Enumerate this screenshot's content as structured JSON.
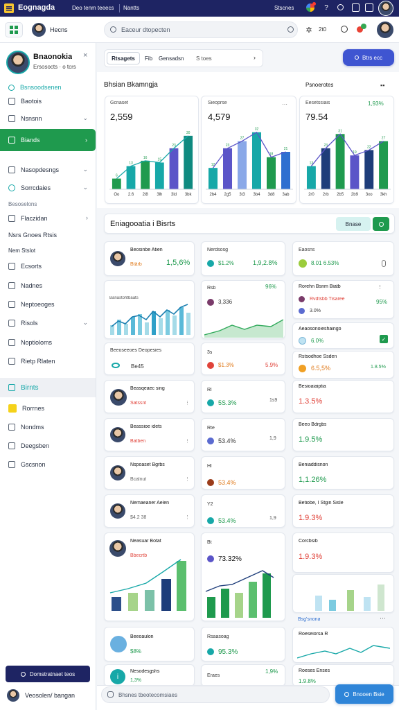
{
  "topbar": {
    "app_name": "Eognagda",
    "menu_1": "Deo tenm teeecs",
    "menu_2": "Nantts",
    "right_label": "Stscnes"
  },
  "header": {
    "left_label": "Hecns",
    "search_placeholder": "Eaceur dtopecten",
    "counter": "2t0"
  },
  "sidebar": {
    "profile_name": "Bnaonokia",
    "profile_sub": "Ersosocts · o tcrs",
    "items": [
      {
        "label": "Bsnsoodsenen"
      },
      {
        "label": "Baotois"
      },
      {
        "label": "Nsnsnn"
      },
      {
        "label": "Biands"
      },
      {
        "label": "Nasopdesngs"
      },
      {
        "label": "Sorrcdaies"
      },
      {
        "label": "Besoselons"
      },
      {
        "label": "Flaczidan"
      },
      {
        "label": "Nsrs Gnoes Rtsis"
      },
      {
        "label": "Nem Stslot"
      },
      {
        "label": "Ecsorts"
      },
      {
        "label": "Nadnes"
      },
      {
        "label": "Neptoeoges"
      },
      {
        "label": "Risols"
      },
      {
        "label": "Noptioloms"
      },
      {
        "label": "Rietp Rlaten"
      },
      {
        "label": "Birnts"
      },
      {
        "label": "Rorrnes"
      },
      {
        "label": "Nondms"
      },
      {
        "label": "Deegsben"
      },
      {
        "label": "Gscsnon"
      }
    ],
    "bottom_button": "Domstratnaet teos",
    "user_name": "Veosolen/ bangan"
  },
  "tabs": [
    "Rtsagets",
    "Fib",
    "Gensadsn",
    "S toes"
  ],
  "action_button": "Btrs ecc",
  "section1": {
    "title": "Bhsian Bkamngja",
    "side_title": "Psnoerotes"
  },
  "charts": [
    {
      "label": "Gcnaset",
      "value": "2,559"
    },
    {
      "label": "Sieoprse",
      "value": "4,579"
    },
    {
      "label": "Eesetssiais",
      "value": "79.54",
      "change": "1,93%"
    }
  ],
  "chart_data": [
    {
      "type": "bar",
      "categories": [
        "Oo",
        "2.6",
        "2l8",
        "3lh",
        "3ld",
        "3bk"
      ],
      "values": [
        6,
        13,
        16,
        15,
        23,
        30
      ],
      "ylim": [
        0,
        35
      ]
    },
    {
      "type": "bar",
      "categories": [
        "2b4",
        "2g5",
        "3t3",
        "3b4",
        "3d8",
        "3ab"
      ],
      "values": [
        12,
        23,
        27,
        32,
        18,
        21
      ],
      "ylim": [
        0,
        35
      ]
    },
    {
      "type": "bar",
      "categories": [
        "2r0",
        "2rb",
        "2b5",
        "2b9",
        "3xo",
        "3kh"
      ],
      "values": [
        13,
        23,
        31,
        19,
        22,
        27
      ],
      "ylim": [
        0,
        35
      ]
    }
  ],
  "section2": {
    "title": "Eniagooatia i Bisrts",
    "button": "Bnase"
  },
  "col1": [
    {
      "name": "Beosinbe Atien",
      "value": "1,5,6%",
      "sub": "Btärb"
    },
    {
      "name": "Banastohtbaats",
      "value": "",
      "sub": ""
    },
    {
      "name": "Beeoseeoes Deopesies",
      "value": "Be45",
      "sub": ""
    },
    {
      "name": "Beasqeaec sing",
      "value": "",
      "sub": "Satssnt"
    },
    {
      "name": "Beassioe idets",
      "value": "",
      "sub": "Batben"
    },
    {
      "name": "Nspoaset Bgrbs",
      "value": "",
      "sub": "Bcalnut"
    },
    {
      "name": "Nemaeaner Aelen",
      "value": "",
      "sub": "$4.2 38"
    },
    {
      "name": "Neasuar Botat",
      "value": "",
      "sub": "Bbecrtb"
    },
    {
      "name": "Beeoaulon",
      "value": "",
      "sub": "$8%"
    },
    {
      "name": "Nesodesgshs",
      "value": "1,3%",
      "sub": ""
    }
  ],
  "col2": [
    {
      "name": "Nerdsosg",
      "value": "$1.2%",
      "pct": "1,9,2.8%"
    },
    {
      "name": "Rsb",
      "value": "3,336",
      "pct": "96%"
    },
    {
      "name": "3s",
      "value": "$1.3%",
      "pct": "5.9%"
    },
    {
      "name": "Rl",
      "value": "5S.3%",
      "pct": "1s9"
    },
    {
      "name": "Rte",
      "value": "53.4%",
      "pct": "1,9"
    },
    {
      "name": "Hl",
      "value": "53.4%",
      "pct": ""
    },
    {
      "name": "Y2",
      "value": "53.4%",
      "pct": "1,9"
    },
    {
      "name": "Bt",
      "value": "73.32%",
      "pct": ""
    },
    {
      "name": "Rsaasoag",
      "value": "95.3%",
      "pct": ""
    },
    {
      "name": "Eraes",
      "value": "",
      "pct": "1,9%"
    }
  ],
  "col3": [
    {
      "name": "Eaosns",
      "value": "8.01 6.53%"
    },
    {
      "name": "Rorehn Bsnm Biatb",
      "value": "",
      "pct": "95%"
    },
    {
      "name": "Rvdtsbb Tisaree",
      "value": "3.0%"
    },
    {
      "name": "Aeaosonoieshaingo",
      "value": "6.0%"
    },
    {
      "name": "Rstsodhoe Ssden",
      "value": "6.5,5%",
      "pct": "1.8.5%"
    },
    {
      "name": "Besioaiaiptia",
      "value": "1.3.5%"
    },
    {
      "name": "Beeo Bdrgbs",
      "value": "1.9.5%"
    },
    {
      "name": "Beniaddisnon",
      "value": "1,1.26%"
    },
    {
      "name": "Betiobe, I Stgin Sisle",
      "value": "1.9.3%"
    },
    {
      "name": "Corcbsib",
      "value": ""
    },
    {
      "name": "Bsg'snona",
      "value": ""
    },
    {
      "name": "Roeseiorsa R",
      "value": ""
    },
    {
      "name": "Roeses Enses",
      "value": "1.9.8%"
    }
  ],
  "bottom_search_placeholder": "Bhsnes tbeotecomsiaes",
  "float_button": "Bnooen Bsie",
  "colors": {
    "navy": "#1e2463",
    "green": "#1f9a4e",
    "teal": "#17a8a8",
    "purple": "#5b55c8",
    "blue": "#2f6fd0"
  }
}
